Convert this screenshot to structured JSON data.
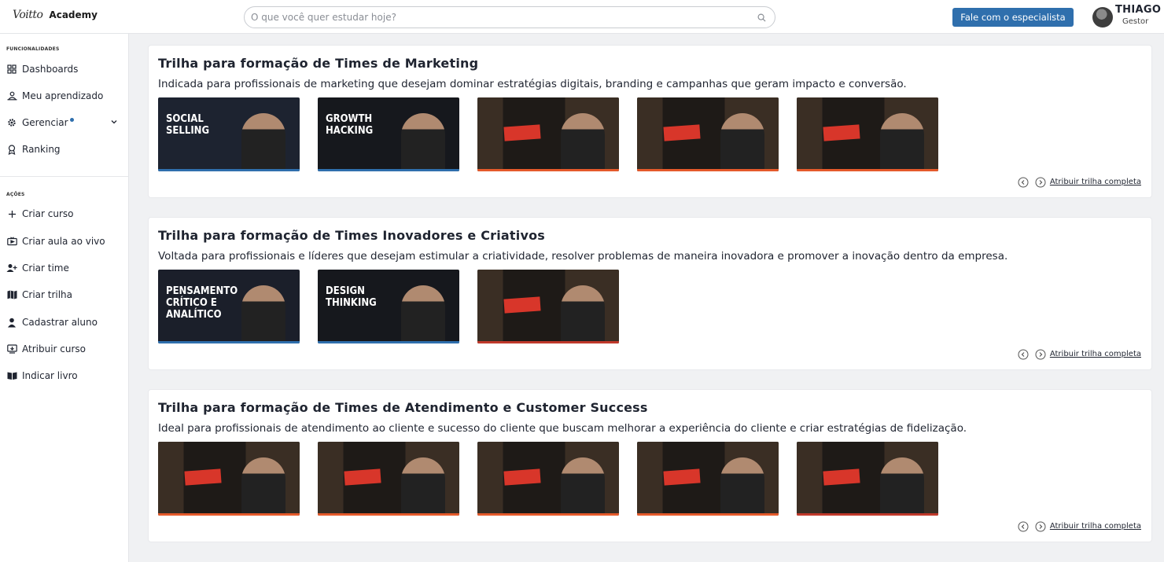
{
  "brand": {
    "logo_mark": "Voitto",
    "product": "Academy"
  },
  "search": {
    "placeholder": "O que você quer estudar hoje?"
  },
  "header": {
    "cta_label": "Fale com o especialista",
    "user_name": "THIAGO",
    "user_role": "Gestor"
  },
  "sidebar": {
    "section_features": "FUNCIONALIDADES",
    "features": [
      {
        "label": "Dashboards",
        "icon": "grid-icon"
      },
      {
        "label": "Meu aprendizado",
        "icon": "user-laptop-icon"
      },
      {
        "label": "Gerenciar",
        "icon": "gear-icon"
      },
      {
        "label": "Ranking",
        "icon": "ribbon-icon"
      }
    ],
    "section_actions": "AÇÕES",
    "actions": [
      {
        "label": "Criar curso",
        "icon": "plus-icon"
      },
      {
        "label": "Criar aula ao vivo",
        "icon": "live-tv-icon"
      },
      {
        "label": "Criar time",
        "icon": "add-team-icon"
      },
      {
        "label": "Criar trilha",
        "icon": "map-icon"
      },
      {
        "label": "Cadastrar aluno",
        "icon": "add-student-icon"
      },
      {
        "label": "Atribuir curso",
        "icon": "assign-icon"
      },
      {
        "label": "Indicar livro",
        "icon": "book-icon"
      }
    ]
  },
  "tracks": [
    {
      "title": "Trilha para formação de Times de Marketing",
      "description": "Indicada para profissionais de marketing que desejam dominar estratégias digitais, branding e campanhas que geram impacto e conversão.",
      "assign_label": "Atribuir trilha completa",
      "courses": [
        {
          "text": "SOCIAL SELLING",
          "bg": "#1d2330",
          "band": "#2f6fad"
        },
        {
          "text": "GROWTH HACKING",
          "bg": "#16181d",
          "band": "#2f6fad"
        },
        {
          "text": "",
          "bg": "#2a2520",
          "band": "#e55a2b"
        },
        {
          "text": "",
          "bg": "#2a2520",
          "band": "#e55a2b"
        },
        {
          "text": "",
          "bg": "#2a2520",
          "band": "#e55a2b"
        }
      ]
    },
    {
      "title": "Trilha para formação de Times Inovadores e Criativos",
      "description": "Voltada para profissionais e líderes que desejam estimular a criatividade, resolver problemas de maneira inovadora e promover a inovação dentro da empresa.",
      "assign_label": "Atribuir trilha completa",
      "courses": [
        {
          "text": "PENSAMENTO CRÍTICO E ANALÍTICO",
          "bg": "#1b1f2a",
          "band": "#2f6fad"
        },
        {
          "text": "DESIGN THINKING",
          "bg": "#16181d",
          "band": "#2f6fad"
        },
        {
          "text": "",
          "bg": "#141414",
          "band": "#c0392b"
        }
      ]
    },
    {
      "title": "Trilha para formação de Times de Atendimento e Customer Success",
      "description": "Ideal para profissionais de atendimento ao cliente e sucesso do cliente que buscam melhorar a experiência do cliente e criar estratégias de fidelização.",
      "assign_label": "Atribuir trilha completa",
      "courses": [
        {
          "text": "",
          "bg": "#2a2520",
          "band": "#e55a2b"
        },
        {
          "text": "",
          "bg": "#2a2520",
          "band": "#e55a2b"
        },
        {
          "text": "",
          "bg": "#2a2520",
          "band": "#e55a2b"
        },
        {
          "text": "",
          "bg": "#2a2520",
          "band": "#e55a2b"
        },
        {
          "text": "",
          "bg": "#141414",
          "band": "#c0392b"
        }
      ]
    }
  ],
  "colors": {
    "accent": "#2f6fad",
    "background": "#f0f1f3"
  }
}
